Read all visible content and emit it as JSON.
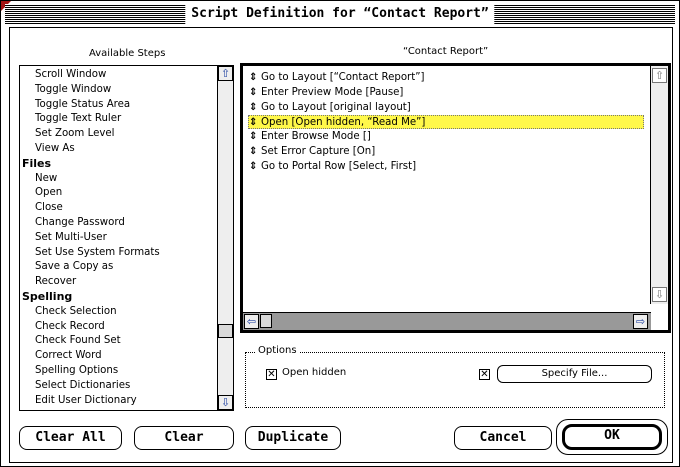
{
  "window": {
    "title": "Script Definition for “Contact Report”"
  },
  "left_header": "Available Steps",
  "right_header": "“Contact Report”",
  "available_steps": [
    {
      "label": "Scroll Window",
      "header": false
    },
    {
      "label": "Toggle Window",
      "header": false
    },
    {
      "label": "Toggle Status Area",
      "header": false
    },
    {
      "label": "Toggle Text Ruler",
      "header": false
    },
    {
      "label": "Set Zoom Level",
      "header": false
    },
    {
      "label": "View As",
      "header": false
    },
    {
      "label": "Files",
      "header": true
    },
    {
      "label": "New",
      "header": false
    },
    {
      "label": "Open",
      "header": false
    },
    {
      "label": "Close",
      "header": false
    },
    {
      "label": "Change Password",
      "header": false
    },
    {
      "label": "Set Multi-User",
      "header": false
    },
    {
      "label": "Set Use System Formats",
      "header": false
    },
    {
      "label": "Save a Copy as",
      "header": false
    },
    {
      "label": "Recover",
      "header": false
    },
    {
      "label": "Spelling",
      "header": true
    },
    {
      "label": "Check Selection",
      "header": false
    },
    {
      "label": "Check Record",
      "header": false
    },
    {
      "label": "Check Found Set",
      "header": false
    },
    {
      "label": "Correct Word",
      "header": false
    },
    {
      "label": "Spelling Options",
      "header": false
    },
    {
      "label": "Select Dictionaries",
      "header": false
    },
    {
      "label": "Edit User Dictionary",
      "header": false
    }
  ],
  "script_steps": [
    {
      "label": "Go to Layout [“Contact Report”]",
      "selected": false
    },
    {
      "label": "Enter Preview Mode [Pause]",
      "selected": false
    },
    {
      "label": "Go to Layout [original layout]",
      "selected": false
    },
    {
      "label": "Open [Open hidden, “Read Me”]",
      "selected": true
    },
    {
      "label": "Enter Browse Mode []",
      "selected": false
    },
    {
      "label": "Set Error Capture [On]",
      "selected": false
    },
    {
      "label": "Go to Portal Row [Select, First]",
      "selected": false
    }
  ],
  "step_marker": "⇕",
  "options": {
    "label": "Options",
    "open_hidden": {
      "label": "Open hidden",
      "checked": true
    },
    "specify_checked": true,
    "specify_button": "Specify File..."
  },
  "buttons": {
    "clear_all": "Clear All",
    "clear": "Clear",
    "duplicate": "Duplicate",
    "cancel": "Cancel",
    "ok": "OK"
  },
  "colors": {
    "selection": "#fff84a",
    "accent": "#1b3ea0"
  }
}
